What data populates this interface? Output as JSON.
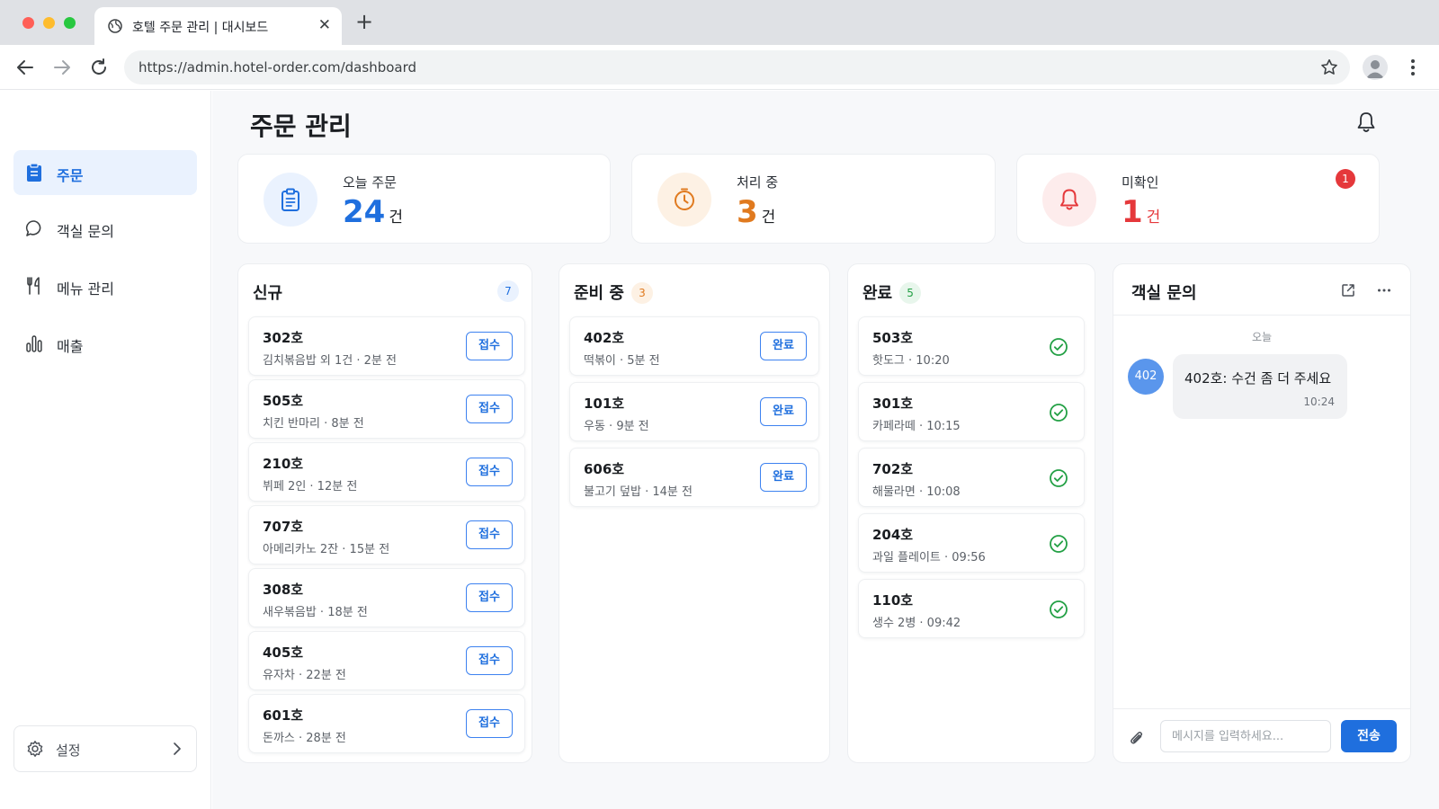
{
  "browser": {
    "tab_title": "호텔 주문 관리 | 대시보드",
    "url": "https://admin.hotel-order.com/dashboard"
  },
  "sidebar": {
    "items": [
      {
        "label": "주문",
        "icon": "clipboard-icon",
        "active": true
      },
      {
        "label": "객실 문의",
        "icon": "chat-bubble-icon"
      },
      {
        "label": "메뉴 관리",
        "icon": "fork-knife-icon"
      },
      {
        "label": "매출",
        "icon": "bar-chart-icon"
      }
    ],
    "settings_label": "설정"
  },
  "header": {
    "title": "주문 관리"
  },
  "stats": [
    {
      "label": "오늘 주문",
      "value": "24",
      "unit": "건",
      "color": "#1f6fde"
    },
    {
      "label": "처리 중",
      "value": "3",
      "unit": "건",
      "color": "#e07a1f"
    },
    {
      "label": "미확인",
      "value": "1",
      "unit": "건",
      "color": "#e5383b",
      "badge": "1"
    }
  ],
  "columns": {
    "new": {
      "title": "신규",
      "count": "7",
      "action_label": "접수",
      "cards": [
        {
          "room": "302호",
          "meta": "김치볶음밥 외 1건 · 2분 전"
        },
        {
          "room": "505호",
          "meta": "치킨 반마리 · 8분 전"
        },
        {
          "room": "210호",
          "meta": "뷔페 2인 · 12분 전"
        },
        {
          "room": "707호",
          "meta": "아메리카노 2잔 · 15분 전"
        },
        {
          "room": "308호",
          "meta": "새우볶음밥 · 18분 전"
        },
        {
          "room": "405호",
          "meta": "유자차 · 22분 전"
        },
        {
          "room": "601호",
          "meta": "돈까스 · 28분 전"
        }
      ]
    },
    "preparing": {
      "title": "준비 중",
      "count": "3",
      "action_label": "완료",
      "cards": [
        {
          "room": "402호",
          "meta": "떡볶이 · 5분 전"
        },
        {
          "room": "101호",
          "meta": "우동 · 9분 전"
        },
        {
          "room": "606호",
          "meta": "불고기 덮밥 · 14분 전"
        }
      ]
    },
    "done": {
      "title": "완료",
      "count": "5",
      "cards": [
        {
          "room": "503호",
          "meta": "핫도그 · 10:20"
        },
        {
          "room": "301호",
          "meta": "카페라떼 · 10:15"
        },
        {
          "room": "702호",
          "meta": "해물라면 · 10:08"
        },
        {
          "room": "204호",
          "meta": "과일 플레이트 · 09:56"
        },
        {
          "room": "110호",
          "meta": "생수 2병 · 09:42"
        }
      ]
    }
  },
  "chat": {
    "title": "객실 문의",
    "day_label": "오늘",
    "messages": [
      {
        "avatar": "402",
        "text": "402호: 수건 좀 더 주세요",
        "time": "10:24"
      }
    ],
    "input_placeholder": "메시지를 입력하세요...",
    "send_label": "전송"
  }
}
